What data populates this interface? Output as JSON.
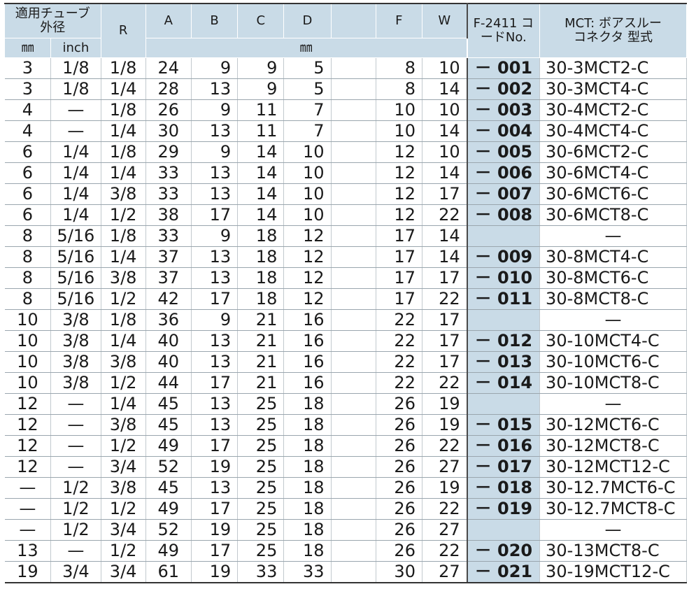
{
  "headers": {
    "tube_od": "適用チューブ外径",
    "mm": "㎜",
    "inch": "inch",
    "r": "R",
    "a": "A",
    "b": "B",
    "c": "C",
    "d": "D",
    "e": "",
    "f": "F",
    "w": "W",
    "code": "F-2411 コードNo.",
    "mct": "MCT: ボアスルーコネクタ 型式",
    "unit_mm": "㎜"
  },
  "rows": [
    {
      "mm": "3",
      "inch": "1/8",
      "r": "1/8",
      "a": "24",
      "b": "9",
      "c": "9",
      "d": "5",
      "e": "",
      "f": "8",
      "w": "10",
      "code": "－ 001",
      "mct": "30-3MCT2-C"
    },
    {
      "mm": "3",
      "inch": "1/8",
      "r": "1/4",
      "a": "28",
      "b": "13",
      "c": "9",
      "d": "5",
      "e": "",
      "f": "8",
      "w": "14",
      "code": "－ 002",
      "mct": "30-3MCT4-C"
    },
    {
      "mm": "4",
      "inch": "—",
      "r": "1/8",
      "a": "26",
      "b": "9",
      "c": "11",
      "d": "7",
      "e": "",
      "f": "10",
      "w": "10",
      "code": "－ 003",
      "mct": "30-4MCT2-C"
    },
    {
      "mm": "4",
      "inch": "—",
      "r": "1/4",
      "a": "30",
      "b": "13",
      "c": "11",
      "d": "7",
      "e": "",
      "f": "10",
      "w": "14",
      "code": "－ 004",
      "mct": "30-4MCT4-C"
    },
    {
      "mm": "6",
      "inch": "1/4",
      "r": "1/8",
      "a": "29",
      "b": "9",
      "c": "14",
      "d": "10",
      "e": "",
      "f": "12",
      "w": "10",
      "code": "－ 005",
      "mct": "30-6MCT2-C"
    },
    {
      "mm": "6",
      "inch": "1/4",
      "r": "1/4",
      "a": "33",
      "b": "13",
      "c": "14",
      "d": "10",
      "e": "",
      "f": "12",
      "w": "14",
      "code": "－ 006",
      "mct": "30-6MCT4-C"
    },
    {
      "mm": "6",
      "inch": "1/4",
      "r": "3/8",
      "a": "33",
      "b": "13",
      "c": "14",
      "d": "10",
      "e": "",
      "f": "12",
      "w": "17",
      "code": "－ 007",
      "mct": "30-6MCT6-C"
    },
    {
      "mm": "6",
      "inch": "1/4",
      "r": "1/2",
      "a": "38",
      "b": "17",
      "c": "14",
      "d": "10",
      "e": "",
      "f": "12",
      "w": "22",
      "code": "－ 008",
      "mct": "30-6MCT8-C"
    },
    {
      "mm": "8",
      "inch": "5/16",
      "r": "1/8",
      "a": "33",
      "b": "9",
      "c": "18",
      "d": "12",
      "e": "",
      "f": "17",
      "w": "14",
      "code": "",
      "mct": "—"
    },
    {
      "mm": "8",
      "inch": "5/16",
      "r": "1/4",
      "a": "37",
      "b": "13",
      "c": "18",
      "d": "12",
      "e": "",
      "f": "17",
      "w": "14",
      "code": "－ 009",
      "mct": "30-8MCT4-C"
    },
    {
      "mm": "8",
      "inch": "5/16",
      "r": "3/8",
      "a": "37",
      "b": "13",
      "c": "18",
      "d": "12",
      "e": "",
      "f": "17",
      "w": "17",
      "code": "－ 010",
      "mct": "30-8MCT6-C"
    },
    {
      "mm": "8",
      "inch": "5/16",
      "r": "1/2",
      "a": "42",
      "b": "17",
      "c": "18",
      "d": "12",
      "e": "",
      "f": "17",
      "w": "22",
      "code": "－ 011",
      "mct": "30-8MCT8-C"
    },
    {
      "mm": "10",
      "inch": "3/8",
      "r": "1/8",
      "a": "36",
      "b": "9",
      "c": "21",
      "d": "16",
      "e": "",
      "f": "22",
      "w": "17",
      "code": "",
      "mct": "—"
    },
    {
      "mm": "10",
      "inch": "3/8",
      "r": "1/4",
      "a": "40",
      "b": "13",
      "c": "21",
      "d": "16",
      "e": "",
      "f": "22",
      "w": "17",
      "code": "－ 012",
      "mct": "30-10MCT4-C"
    },
    {
      "mm": "10",
      "inch": "3/8",
      "r": "3/8",
      "a": "40",
      "b": "13",
      "c": "21",
      "d": "16",
      "e": "",
      "f": "22",
      "w": "17",
      "code": "－ 013",
      "mct": "30-10MCT6-C"
    },
    {
      "mm": "10",
      "inch": "3/8",
      "r": "1/2",
      "a": "44",
      "b": "17",
      "c": "21",
      "d": "16",
      "e": "",
      "f": "22",
      "w": "22",
      "code": "－ 014",
      "mct": "30-10MCT8-C"
    },
    {
      "mm": "12",
      "inch": "—",
      "r": "1/4",
      "a": "45",
      "b": "13",
      "c": "25",
      "d": "18",
      "e": "",
      "f": "26",
      "w": "19",
      "code": "",
      "mct": "—"
    },
    {
      "mm": "12",
      "inch": "—",
      "r": "3/8",
      "a": "45",
      "b": "13",
      "c": "25",
      "d": "18",
      "e": "",
      "f": "26",
      "w": "19",
      "code": "－ 015",
      "mct": "30-12MCT6-C"
    },
    {
      "mm": "12",
      "inch": "—",
      "r": "1/2",
      "a": "49",
      "b": "17",
      "c": "25",
      "d": "18",
      "e": "",
      "f": "26",
      "w": "22",
      "code": "－ 016",
      "mct": "30-12MCT8-C"
    },
    {
      "mm": "12",
      "inch": "—",
      "r": "3/4",
      "a": "52",
      "b": "19",
      "c": "25",
      "d": "18",
      "e": "",
      "f": "26",
      "w": "27",
      "code": "－ 017",
      "mct": "30-12MCT12-C"
    },
    {
      "mm": "—",
      "inch": "1/2",
      "r": "3/8",
      "a": "45",
      "b": "13",
      "c": "25",
      "d": "18",
      "e": "",
      "f": "26",
      "w": "19",
      "code": "－ 018",
      "mct": "30-12.7MCT6-C"
    },
    {
      "mm": "—",
      "inch": "1/2",
      "r": "1/2",
      "a": "49",
      "b": "17",
      "c": "25",
      "d": "18",
      "e": "",
      "f": "26",
      "w": "22",
      "code": "－ 019",
      "mct": "30-12.7MCT8-C"
    },
    {
      "mm": "—",
      "inch": "1/2",
      "r": "3/4",
      "a": "52",
      "b": "19",
      "c": "25",
      "d": "18",
      "e": "",
      "f": "26",
      "w": "27",
      "code": "",
      "mct": "—"
    },
    {
      "mm": "13",
      "inch": "—",
      "r": "1/2",
      "a": "49",
      "b": "17",
      "c": "25",
      "d": "18",
      "e": "",
      "f": "26",
      "w": "22",
      "code": "－ 020",
      "mct": "30-13MCT8-C"
    },
    {
      "mm": "19",
      "inch": "3/4",
      "r": "3/4",
      "a": "61",
      "b": "19",
      "c": "33",
      "d": "33",
      "e": "",
      "f": "30",
      "w": "27",
      "code": "－ 021",
      "mct": "30-19MCT12-C"
    }
  ]
}
